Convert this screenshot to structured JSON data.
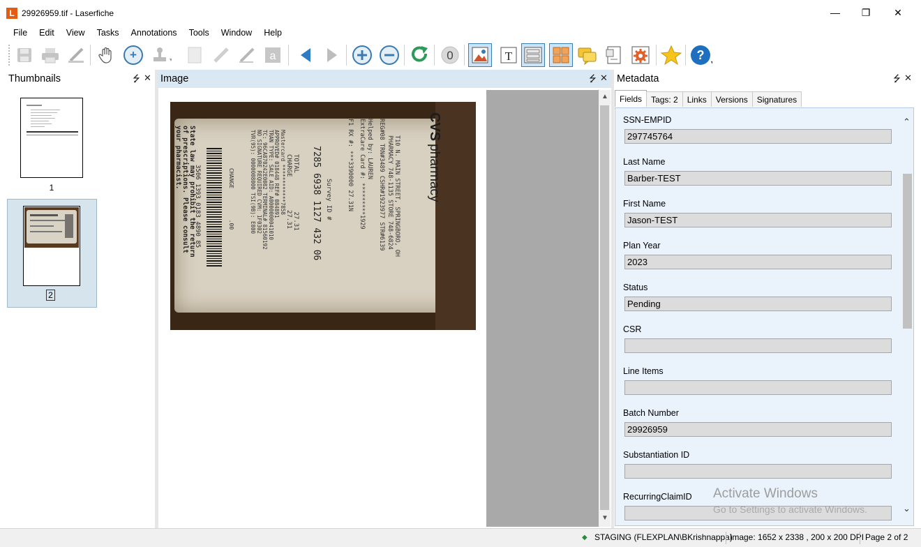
{
  "window": {
    "logo_letter": "L",
    "title": "29926959.tif - Laserfiche",
    "minimize_glyph": "—",
    "restore_glyph": "❐",
    "close_glyph": "✕"
  },
  "menu": [
    "File",
    "Edit",
    "View",
    "Tasks",
    "Annotations",
    "Tools",
    "Window",
    "Help"
  ],
  "toolbar": {
    "icons": [
      "save-icon",
      "print-icon",
      "edit-pen-icon",
      "pan-hand-icon",
      "zoom-in-magnifier-icon",
      "stamp-icon",
      "sticky-note-icon",
      "highlight-pen-icon",
      "draw-pen-icon",
      "text-annotation-icon",
      "previous-page-icon",
      "next-page-icon",
      "zoom-in-icon",
      "zoom-out-icon",
      "rotate-icon",
      "ocr-icon",
      "image-view-icon",
      "text-view-icon",
      "fields-view-icon",
      "thumbnails-view-icon",
      "annotations-view-icon",
      "properties-view-icon",
      "settings-icon",
      "favorite-star-icon",
      "help-icon"
    ],
    "text_tool_letter": "a",
    "text_view_letter": "T",
    "help_letter": "?",
    "ocr_letter": "0"
  },
  "thumbnails_pane": {
    "title": "Thumbnails",
    "pin_glyph": "⭍",
    "close_glyph": "✕",
    "pages": [
      {
        "label": "1",
        "selected": false
      },
      {
        "label": "2",
        "selected": true
      }
    ]
  },
  "image_pane": {
    "title": "Image",
    "pin_glyph": "⭍",
    "close_glyph": "✕",
    "receipt": {
      "brand": "CVS pharmacy",
      "brand_big": "CVS",
      "brand_small": "pharmacy",
      "address_line1": "T10 N. MAIN STREET, SPRINGBORO, OH",
      "address_line2": "PHARMACY 748-1135  STORE 748-6824",
      "reg_line": "REG#08 TRN#3489 CSHR#1923977 STR#6139",
      "helped_by": "Helped by: LAUREN",
      "extracare": "ExtraCare Card #: *********1929",
      "rx_line": "F1 RX #: ***3390000      27.31N",
      "survey_label": "Survey ID #",
      "survey_id": "7285 6938 1127 432 06",
      "total_label": "TOTAL",
      "total_value": "27.31",
      "charge_label": "CHARGE",
      "charge_value": "27.31",
      "card_lines": [
        "Mastercard  ************7858",
        "APPROVED# 018448       REF# 084891",
        "TRAN TYPE: SALE        AID: A0000000041010",
        "TC: 96CA870242E0082    TERMINAL# 81560192",
        "NO SIGNATURE REQUIRED  CVM: 1F0302",
        "TVR(95): 0000008000    TSI(9B): E800"
      ],
      "change_label": "CHANGE",
      "change_value": ".00",
      "barcode_number": "3506 1393 0183 4890 85",
      "footer_lines": [
        "State law may prohibit the return",
        "of prescriptions. Please consult",
        "your pharmacist."
      ]
    }
  },
  "metadata_pane": {
    "title": "Metadata",
    "pin_glyph": "⭍",
    "close_glyph": "✕",
    "tabs": [
      {
        "label": "Fields",
        "active": true
      },
      {
        "label": "Tags: 2",
        "active": false
      },
      {
        "label": "Links",
        "active": false
      },
      {
        "label": "Versions",
        "active": false
      },
      {
        "label": "Signatures",
        "active": false
      }
    ],
    "fields": [
      {
        "label": "SSN-EMPID",
        "value": "297745764"
      },
      {
        "label": "Last Name",
        "value": "Barber-TEST"
      },
      {
        "label": "First Name",
        "value": "Jason-TEST"
      },
      {
        "label": "Plan Year",
        "value": "2023"
      },
      {
        "label": "Status",
        "value": "Pending"
      },
      {
        "label": "CSR",
        "value": ""
      },
      {
        "label": "Line Items",
        "value": ""
      },
      {
        "label": "Batch Number",
        "value": "29926959"
      },
      {
        "label": "Substantiation ID",
        "value": ""
      },
      {
        "label": "RecurringClaimID",
        "value": ""
      }
    ]
  },
  "watermark": {
    "line1": "Activate Windows",
    "line2": "Go to Settings to activate Windows."
  },
  "status_bar": {
    "connection": "STAGING (FLEXPLAN\\BKrishnappa)",
    "image_info": "Image: 1652 x 2338 , 200 x 200 DPI",
    "page_info": "Page 2 of 2"
  },
  "colors": {
    "accent": "#3c7fb1",
    "selected_bg": "#cce4f7",
    "metadata_bg": "#eaf2fb",
    "logo": "#e35c13"
  }
}
